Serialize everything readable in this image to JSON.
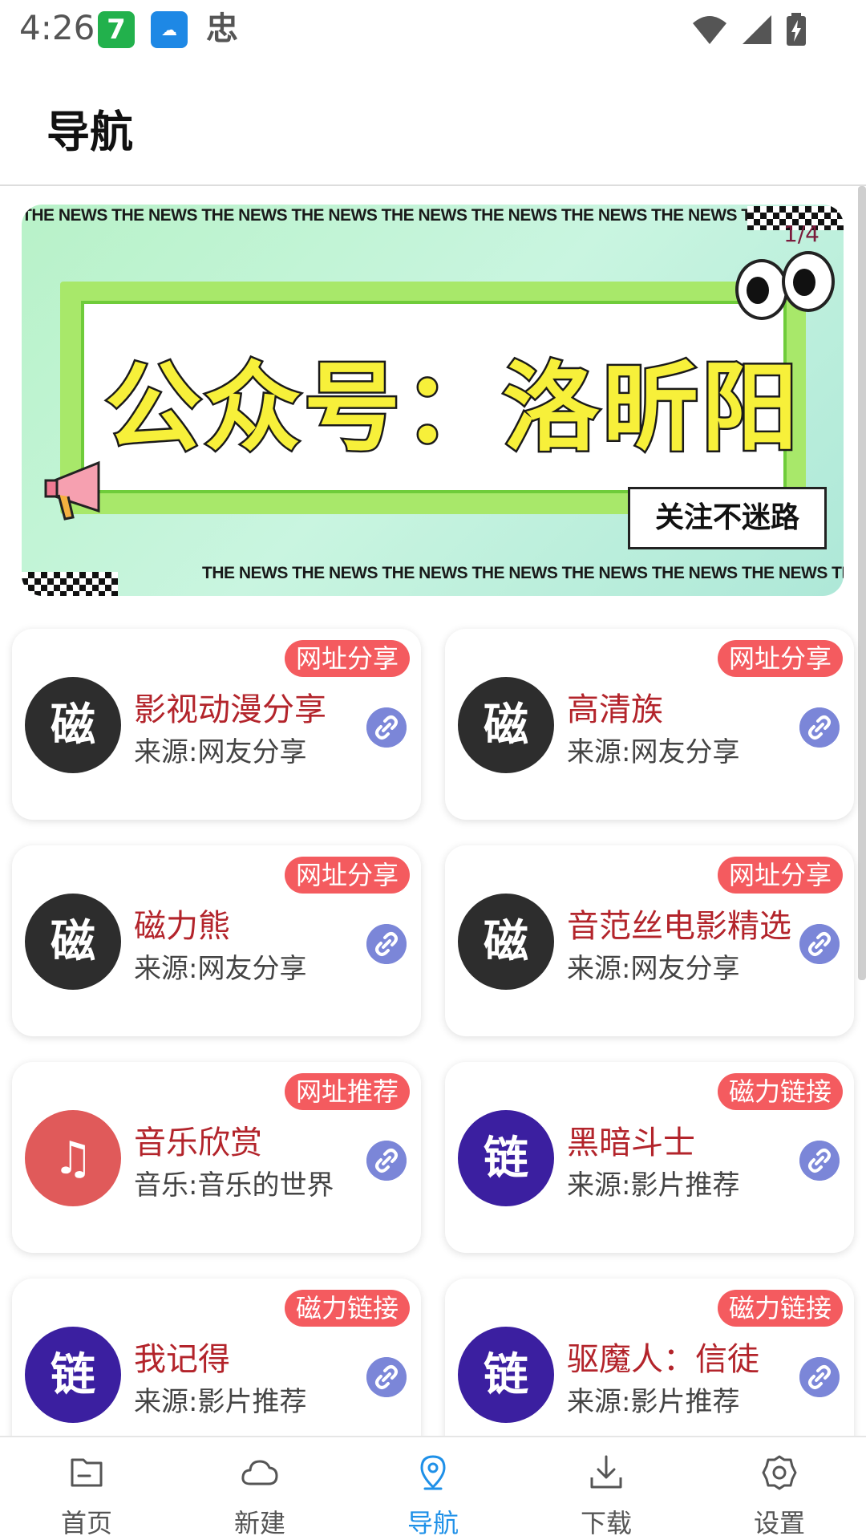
{
  "status_bar": {
    "time": "4:26",
    "app_icon_1": "7",
    "app_icon_2": "☁",
    "app_icon_3": "忠"
  },
  "header": {
    "title": "导航"
  },
  "banner": {
    "counter": "1/4",
    "headline": "公众号：洛昕阳",
    "follow_label": "关注不迷路",
    "news_strip": "THE NEWS  THE NEWS  THE NEWS  THE NEWS  THE NEWS  THE NEWS  THE NEWS  THE NEWS  THE NEWS  THE NEWS"
  },
  "cards": [
    {
      "tag": "网址分享",
      "avatar": "磁",
      "avatar_style": "dark",
      "title": "影视动漫分享",
      "subtitle": "来源:网友分享"
    },
    {
      "tag": "网址分享",
      "avatar": "磁",
      "avatar_style": "dark",
      "title": "高清族",
      "subtitle": "来源:网友分享"
    },
    {
      "tag": "网址分享",
      "avatar": "磁",
      "avatar_style": "dark",
      "title": "磁力熊",
      "subtitle": "来源:网友分享"
    },
    {
      "tag": "网址分享",
      "avatar": "磁",
      "avatar_style": "dark",
      "title": "音范丝电影精选",
      "subtitle": "来源:网友分享"
    },
    {
      "tag": "网址推荐",
      "avatar": "♫",
      "avatar_style": "music",
      "title": "音乐欣赏",
      "subtitle": "音乐:音乐的世界"
    },
    {
      "tag": "磁力链接",
      "avatar": "链",
      "avatar_style": "purple",
      "title": "黑暗斗士",
      "subtitle": "来源:影片推荐"
    },
    {
      "tag": "磁力链接",
      "avatar": "链",
      "avatar_style": "purple",
      "title": "我记得",
      "subtitle": "来源:影片推荐"
    },
    {
      "tag": "磁力链接",
      "avatar": "链",
      "avatar_style": "purple",
      "title": "驱魔人：信徒",
      "subtitle": "来源:影片推荐"
    }
  ],
  "bottom_nav": [
    {
      "label": "首页",
      "icon": "folder-icon",
      "active": false
    },
    {
      "label": "新建",
      "icon": "cloud-icon",
      "active": false
    },
    {
      "label": "导航",
      "icon": "location-pin-icon",
      "active": true
    },
    {
      "label": "下载",
      "icon": "download-icon",
      "active": false
    },
    {
      "label": "设置",
      "icon": "gear-icon",
      "active": false
    }
  ],
  "colors": {
    "accent": "#1e90e8",
    "tag": "#f45b5f",
    "card_title": "#b3242b",
    "link_button": "#7b86d8"
  }
}
